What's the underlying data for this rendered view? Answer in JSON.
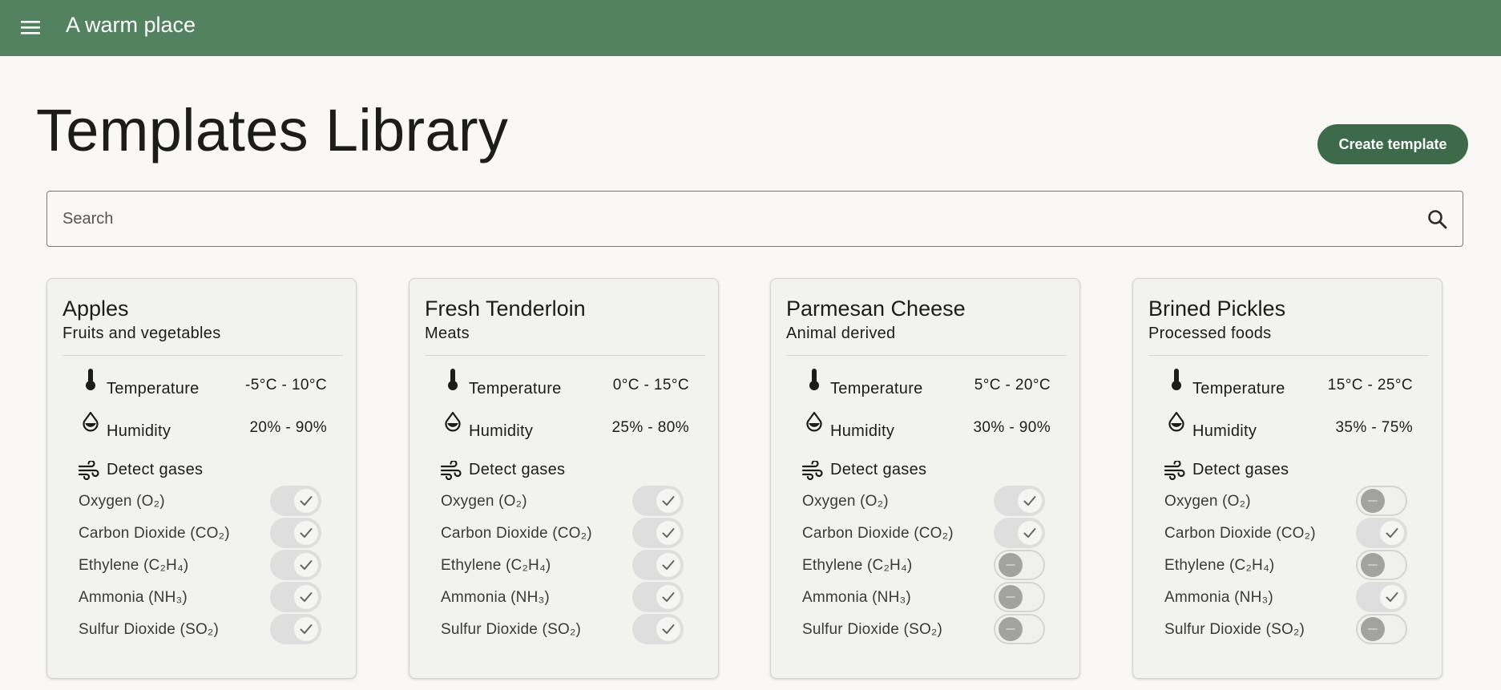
{
  "app": {
    "title": "A warm place"
  },
  "page": {
    "title": "Templates Library",
    "create_label": "Create template"
  },
  "search": {
    "placeholder": "Search",
    "value": ""
  },
  "labels": {
    "temperature": "Temperature",
    "humidity": "Humidity",
    "gases": "Detect gases"
  },
  "gas_names": [
    "Oxygen (O₂)",
    "Carbon Dioxide (CO₂)",
    "Ethylene (C₂H₄)",
    "Ammonia (NH₃)",
    "Sulfur Dioxide (SO₂)"
  ],
  "cards": [
    {
      "title": "Apples",
      "category": "Fruits and vegetables",
      "temperature": "-5°C - 10°C",
      "humidity": "20% - 90%",
      "gases": [
        true,
        true,
        true,
        true,
        true
      ]
    },
    {
      "title": "Fresh Tenderloin",
      "category": "Meats",
      "temperature": "0°C - 15°C",
      "humidity": "25% - 80%",
      "gases": [
        true,
        true,
        true,
        true,
        true
      ]
    },
    {
      "title": "Parmesan Cheese",
      "category": "Animal derived",
      "temperature": "5°C - 20°C",
      "humidity": "30% - 90%",
      "gases": [
        true,
        true,
        false,
        false,
        false
      ]
    },
    {
      "title": "Brined Pickles",
      "category": "Processed foods",
      "temperature": "15°C - 25°C",
      "humidity": "35% - 75%",
      "gases": [
        false,
        true,
        false,
        true,
        false
      ]
    }
  ],
  "colors": {
    "appbar": "#52825f",
    "button": "#3c6a4b",
    "background": "#f9f8f4",
    "card": "#f2f2ee"
  },
  "icons": {
    "menu": "menu-icon",
    "search": "search-icon",
    "temperature": "thermometer-icon",
    "humidity": "water-drop-icon",
    "gases": "air-icon",
    "toggle_on": "check-icon",
    "toggle_off": "minus-icon"
  }
}
